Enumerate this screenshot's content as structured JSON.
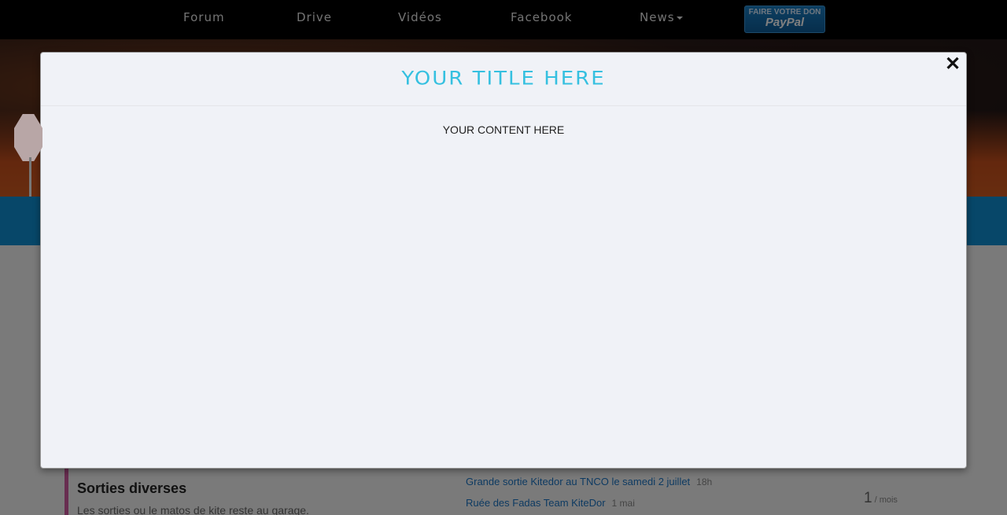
{
  "nav": {
    "items": [
      "Forum",
      "Drive",
      "Vidéos",
      "Facebook"
    ],
    "news_label": "News",
    "donate_top": "FAIRE VOTRE DON",
    "donate_brand": "PayPal"
  },
  "forum": {
    "title": "Sorties diverses",
    "description": "Les sorties ou le matos de kite reste au garage.",
    "topics": [
      {
        "title": "Grande sortie Kitedor au TNCO le samedi 2 juillet",
        "age": "18h"
      },
      {
        "title": "Ruée des Fadas Team KiteDor",
        "age": "1 mai"
      }
    ],
    "stat_value": "1",
    "stat_unit": "/ mois"
  },
  "modal": {
    "title": "YOUR TITLE HERE",
    "content": "YOUR CONTENT HERE",
    "close_symbol": "✕"
  },
  "colors": {
    "modal_title": "#35c0e0",
    "blue_bar": "#0e8fd3",
    "forum_accent": "#d05aa0",
    "link": "#1a74c4"
  }
}
